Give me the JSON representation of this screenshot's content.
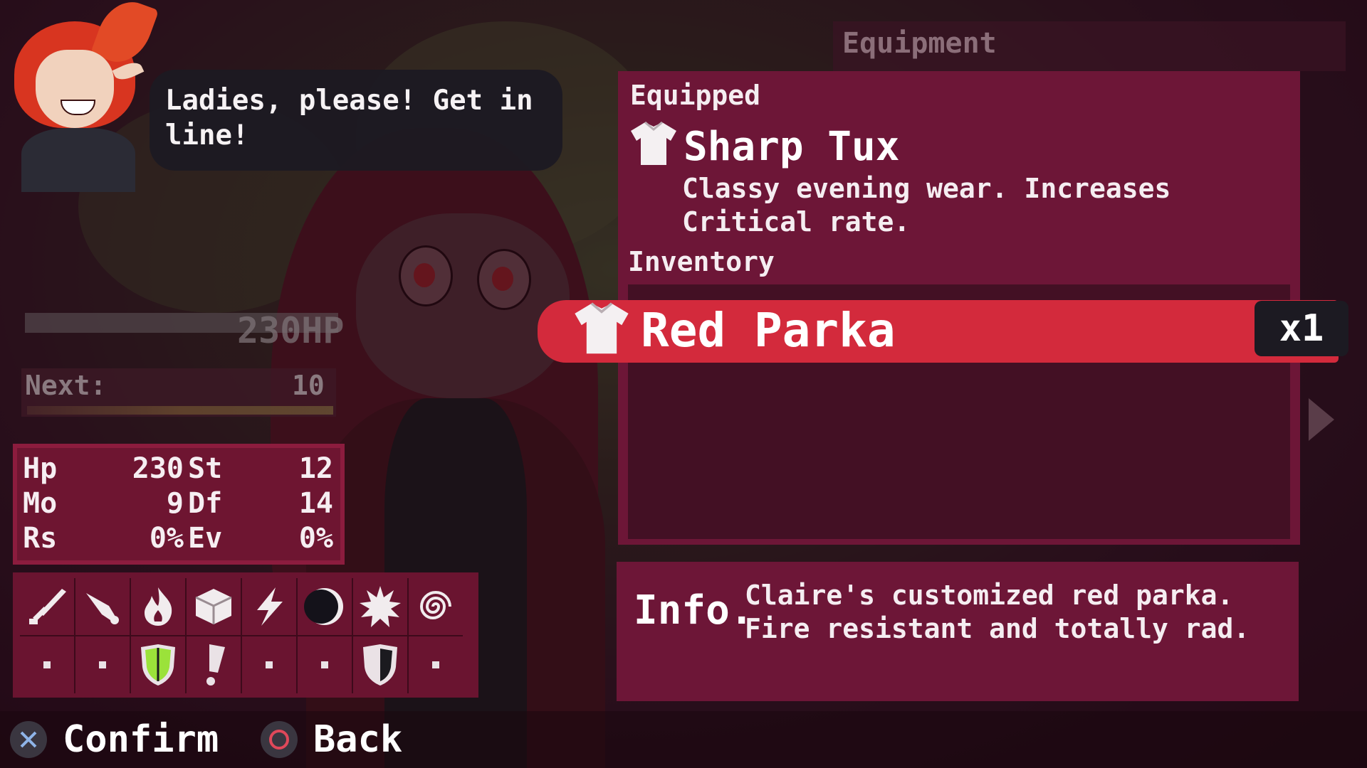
{
  "dialogue": {
    "text": "Ladies, please! Get in line!"
  },
  "character": {
    "hp_display": "230HP",
    "next_label": "Next:",
    "next_value": "10"
  },
  "stats": {
    "hp": {
      "label": "Hp",
      "value": "230"
    },
    "st": {
      "label": "St",
      "value": "12"
    },
    "mo": {
      "label": "Mo",
      "value": "9"
    },
    "df": {
      "label": "Df",
      "value": "14"
    },
    "rs": {
      "label": "Rs",
      "value": "0%"
    },
    "ev": {
      "label": "Ev",
      "value": "0%"
    }
  },
  "elements": [
    {
      "icon": "sword-icon",
      "resistance": "none"
    },
    {
      "icon": "dagger-icon",
      "resistance": "none"
    },
    {
      "icon": "fire-icon",
      "resistance": "resist"
    },
    {
      "icon": "ice-cube-icon",
      "resistance": "weak"
    },
    {
      "icon": "lightning-icon",
      "resistance": "none"
    },
    {
      "icon": "moon-icon",
      "resistance": "none"
    },
    {
      "icon": "sun-burst-icon",
      "resistance": "half"
    },
    {
      "icon": "spiral-icon",
      "resistance": "none"
    }
  ],
  "equipment": {
    "title": "Equipment",
    "equipped_label": "Equipped",
    "equipped_item": {
      "name": "Sharp Tux",
      "description": "Classy evening wear. Increases Critical rate."
    },
    "inventory_label": "Inventory",
    "inventory": [
      {
        "name": "Red Parka",
        "quantity": "x1",
        "selected": true
      }
    ]
  },
  "info": {
    "label": "Info.",
    "text": "Claire's customized red parka. Fire resistant and totally rad."
  },
  "controls": {
    "confirm": "Confirm",
    "back": "Back"
  },
  "colors": {
    "panel": "#6d1637",
    "panel_dark": "#431024",
    "highlight": "#d32a3c",
    "resist_green": "#9be23a"
  }
}
